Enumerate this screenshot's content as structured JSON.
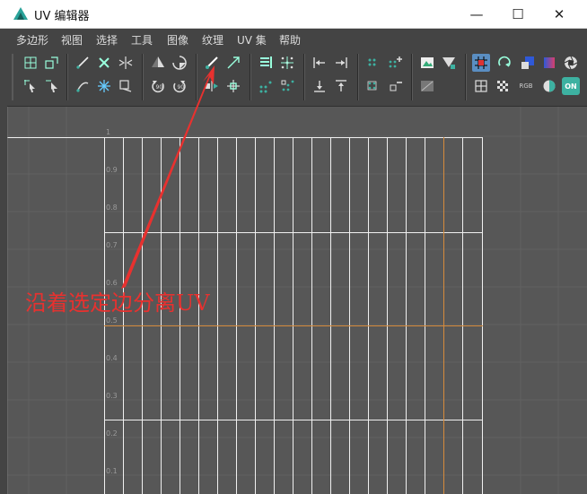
{
  "window": {
    "title": "UV 编辑器",
    "controls": {
      "minimize": "—",
      "maximize": "☐",
      "close": "✕"
    }
  },
  "menubar": {
    "items": [
      "多边形",
      "视图",
      "选择",
      "工具",
      "图像",
      "纹理",
      "UV 集",
      "帮助"
    ]
  },
  "toolbar": {
    "groups": [
      [
        "grid-select-icon",
        "expand-icon",
        "cut-icon",
        "cross-x-icon",
        "arrows-merge-icon",
        "flip-u-icon",
        "flip-v-icon",
        "cut-sew-icon",
        "scale-arrow-icon",
        "align-rows-icon",
        "centroid-icon",
        "align-left-icon",
        "align-right-icon",
        "dots-grid-icon",
        "dots-plus-icon",
        "image-icon",
        "checker-filter-icon",
        "pan-icon",
        "rotate-loop-icon",
        "square-blue-icon",
        "square-gradient-icon",
        "aperture-icon"
      ],
      [
        "select-arrow-icon",
        "select-arrow-alt-icon",
        "unfold-icon",
        "snowflake-icon",
        "layout-icon",
        "rotate-ccw-icon",
        "rotate-cw-icon",
        "move-edge-icon",
        "snap-together-icon",
        "distribute-icon",
        "stack-icon",
        "align-down-icon",
        "align-up-icon",
        "dots-small-icon",
        "minus-icon",
        "texture-dim-icon",
        "grid-square-icon",
        "checker-icon",
        "rgb-icon",
        "sphere-icon",
        "on-icon"
      ]
    ],
    "rgb_label": "RGB",
    "on_label": "ON"
  },
  "viewport": {
    "tick_labels": [
      "1",
      "0.9",
      "0.8",
      "0.7",
      "0.6",
      "0.5",
      "0.4",
      "0.3",
      "0.2",
      "0.1"
    ],
    "annotation": "沿着选定边分离UV"
  },
  "colors": {
    "uv_line": "#f0f0f0",
    "orange_line": "#d68b3c",
    "annotation": "#e8312f",
    "active_button": "#5a8ec2",
    "accent_teal": "#3db1a1"
  }
}
